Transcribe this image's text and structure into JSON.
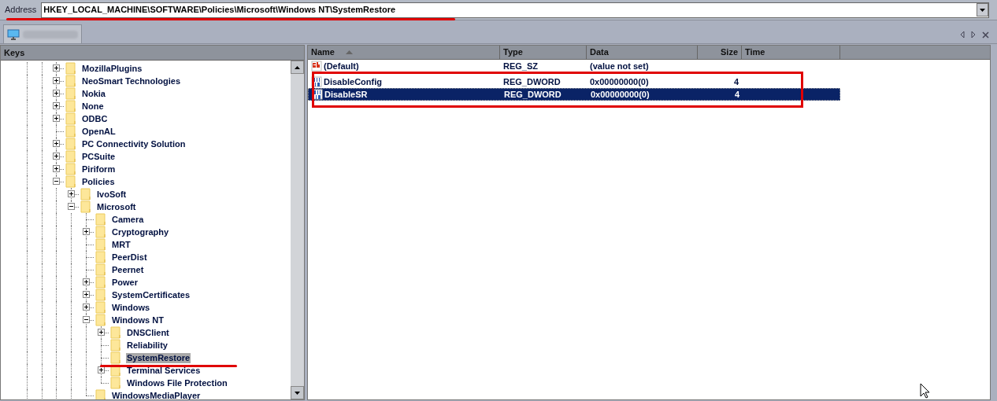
{
  "address": {
    "label": "Address",
    "value": "HKEY_LOCAL_MACHINE\\SOFTWARE\\Policies\\Microsoft\\Windows NT\\SystemRestore"
  },
  "keys_panel": {
    "title": "Keys",
    "tree": [
      {
        "label": "MozillaPlugins",
        "kind": "branch",
        "expanded": false,
        "selected": false
      },
      {
        "label": "NeoSmart Technologies",
        "kind": "branch",
        "expanded": false,
        "selected": false
      },
      {
        "label": "Nokia",
        "kind": "branch",
        "expanded": false,
        "selected": false
      },
      {
        "label": "None",
        "kind": "branch",
        "expanded": false,
        "selected": false
      },
      {
        "label": "ODBC",
        "kind": "branch",
        "expanded": false,
        "selected": false
      },
      {
        "label": "OpenAL",
        "kind": "leaf",
        "selected": false
      },
      {
        "label": "PC Connectivity Solution",
        "kind": "branch",
        "expanded": false,
        "selected": false
      },
      {
        "label": "PCSuite",
        "kind": "branch",
        "expanded": false,
        "selected": false
      },
      {
        "label": "Piriform",
        "kind": "branch",
        "expanded": false,
        "selected": false
      },
      {
        "label": "Policies",
        "kind": "branch",
        "expanded": true,
        "selected": false,
        "children": [
          {
            "label": "IvoSoft",
            "kind": "branch",
            "expanded": false,
            "selected": false
          },
          {
            "label": "Microsoft",
            "kind": "branch",
            "expanded": true,
            "selected": false,
            "children": [
              {
                "label": "Camera",
                "kind": "leaf",
                "selected": false
              },
              {
                "label": "Cryptography",
                "kind": "branch",
                "expanded": false,
                "selected": false
              },
              {
                "label": "MRT",
                "kind": "leaf",
                "selected": false
              },
              {
                "label": "PeerDist",
                "kind": "leaf",
                "selected": false
              },
              {
                "label": "Peernet",
                "kind": "leaf",
                "selected": false
              },
              {
                "label": "Power",
                "kind": "branch",
                "expanded": false,
                "selected": false
              },
              {
                "label": "SystemCertificates",
                "kind": "branch",
                "expanded": false,
                "selected": false
              },
              {
                "label": "Windows",
                "kind": "branch",
                "expanded": false,
                "selected": false
              },
              {
                "label": "Windows NT",
                "kind": "branch",
                "expanded": true,
                "selected": false,
                "children": [
                  {
                    "label": "DNSClient",
                    "kind": "branch",
                    "expanded": false,
                    "selected": false
                  },
                  {
                    "label": "Reliability",
                    "kind": "leaf",
                    "selected": false
                  },
                  {
                    "label": "SystemRestore",
                    "kind": "leaf",
                    "selected": true
                  },
                  {
                    "label": "Terminal Services",
                    "kind": "branch",
                    "expanded": false,
                    "selected": false
                  },
                  {
                    "label": "Windows File Protection",
                    "kind": "leaf",
                    "selected": false
                  }
                ]
              },
              {
                "label": "WindowsMediaPlayer",
                "kind": "leaf",
                "selected": false
              }
            ]
          }
        ]
      }
    ]
  },
  "values_table": {
    "columns": [
      "Name",
      "Type",
      "Data",
      "Size",
      "Time"
    ],
    "rows": [
      {
        "kind": "string",
        "name": "(Default)",
        "type": "REG_SZ",
        "data": "(value not set)",
        "selected": false
      },
      {
        "kind": "binary",
        "name": "DisableConfig",
        "type": "REG_DWORD",
        "data": "0x00000000(0)",
        "size": "4",
        "selected": false
      },
      {
        "kind": "binary",
        "name": "DisableSR",
        "type": "REG_DWORD",
        "data": "0x00000000(0)",
        "size": "4",
        "selected": true
      }
    ]
  }
}
